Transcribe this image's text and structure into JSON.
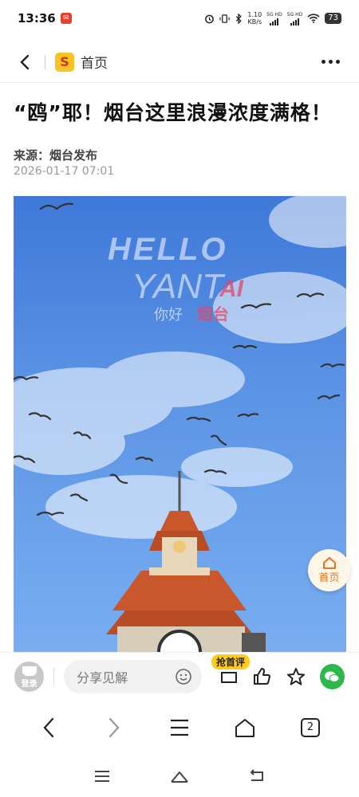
{
  "status_bar": {
    "time": "13:36",
    "speed_value": "1.10",
    "speed_unit": "KB/s",
    "signal_label_1": "5G HD",
    "signal_label_2": "5G HD",
    "battery": "73"
  },
  "top_nav": {
    "home_label": "首页"
  },
  "article": {
    "title": "“鸥”耶！烟台这里浪漫浓度满格！",
    "source": "来源：烟台发布",
    "date": "2026-01-17 07:01",
    "image_text": {
      "line1": "HELLO",
      "line2_a": "YANT",
      "line2_b": "AI",
      "line3_a": "你好",
      "line3_b": "烟台"
    }
  },
  "float_home": {
    "label": "首页"
  },
  "comment_bar": {
    "login_label": "登录",
    "input_placeholder": "分享见解",
    "first_comment_badge": "抢首评"
  },
  "browser_bar": {
    "tabs_count": "2"
  },
  "colors": {
    "accent_orange": "#e8731c",
    "badge_yellow": "#ffcc1a",
    "wechat_green": "#2db84c",
    "sky_blue": "#3f78d8"
  }
}
